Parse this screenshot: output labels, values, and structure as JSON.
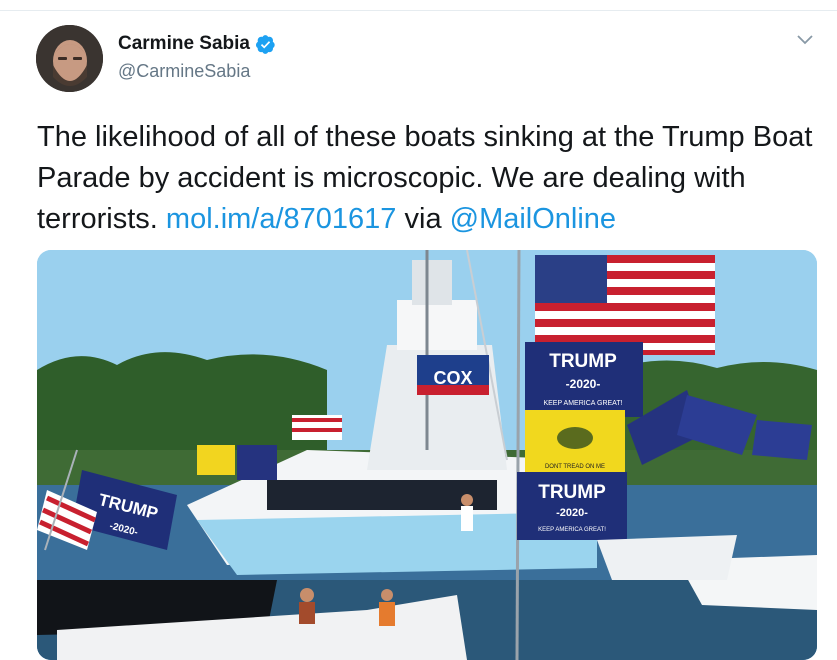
{
  "tweet": {
    "display_name": "Carmine Sabia",
    "handle": "@CarmineSabia",
    "text_before_link": "The likelihood of all of these boats sinking at the Trump Boat Parade by accident is microscopic. We are dealing with terrorists. ",
    "link": "mol.im/a/8701617",
    "text_via": " via ",
    "mention": "@MailOnline"
  },
  "media": {
    "signs": {
      "cox": "COX",
      "trump": "TRUMP",
      "year": "-2020-",
      "slogan": "KEEP AMERICA GREAT!",
      "dont_tread": "DONT TREAD ON ME"
    }
  },
  "icons": {
    "verified": "verified-badge-icon",
    "menu": "chevron-down-icon"
  },
  "colors": {
    "text": "#14171a",
    "secondary": "#657786",
    "link": "#1b95e0",
    "verified": "#1da1f2"
  }
}
